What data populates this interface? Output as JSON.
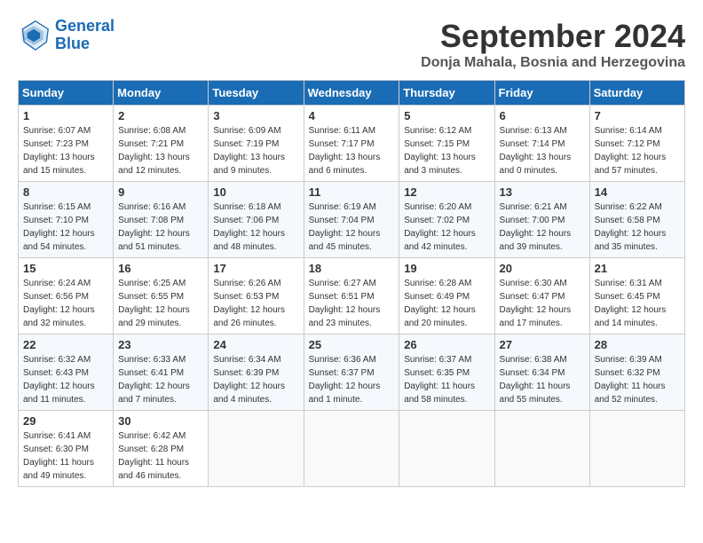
{
  "logo": {
    "line1": "General",
    "line2": "Blue"
  },
  "title": "September 2024",
  "subtitle": "Donja Mahala, Bosnia and Herzegovina",
  "days_header": [
    "Sunday",
    "Monday",
    "Tuesday",
    "Wednesday",
    "Thursday",
    "Friday",
    "Saturday"
  ],
  "weeks": [
    [
      {
        "day": "1",
        "sunrise": "6:07 AM",
        "sunset": "7:23 PM",
        "daylight": "13 hours and 15 minutes."
      },
      {
        "day": "2",
        "sunrise": "6:08 AM",
        "sunset": "7:21 PM",
        "daylight": "13 hours and 12 minutes."
      },
      {
        "day": "3",
        "sunrise": "6:09 AM",
        "sunset": "7:19 PM",
        "daylight": "13 hours and 9 minutes."
      },
      {
        "day": "4",
        "sunrise": "6:11 AM",
        "sunset": "7:17 PM",
        "daylight": "13 hours and 6 minutes."
      },
      {
        "day": "5",
        "sunrise": "6:12 AM",
        "sunset": "7:15 PM",
        "daylight": "13 hours and 3 minutes."
      },
      {
        "day": "6",
        "sunrise": "6:13 AM",
        "sunset": "7:14 PM",
        "daylight": "13 hours and 0 minutes."
      },
      {
        "day": "7",
        "sunrise": "6:14 AM",
        "sunset": "7:12 PM",
        "daylight": "12 hours and 57 minutes."
      }
    ],
    [
      {
        "day": "8",
        "sunrise": "6:15 AM",
        "sunset": "7:10 PM",
        "daylight": "12 hours and 54 minutes."
      },
      {
        "day": "9",
        "sunrise": "6:16 AM",
        "sunset": "7:08 PM",
        "daylight": "12 hours and 51 minutes."
      },
      {
        "day": "10",
        "sunrise": "6:18 AM",
        "sunset": "7:06 PM",
        "daylight": "12 hours and 48 minutes."
      },
      {
        "day": "11",
        "sunrise": "6:19 AM",
        "sunset": "7:04 PM",
        "daylight": "12 hours and 45 minutes."
      },
      {
        "day": "12",
        "sunrise": "6:20 AM",
        "sunset": "7:02 PM",
        "daylight": "12 hours and 42 minutes."
      },
      {
        "day": "13",
        "sunrise": "6:21 AM",
        "sunset": "7:00 PM",
        "daylight": "12 hours and 39 minutes."
      },
      {
        "day": "14",
        "sunrise": "6:22 AM",
        "sunset": "6:58 PM",
        "daylight": "12 hours and 35 minutes."
      }
    ],
    [
      {
        "day": "15",
        "sunrise": "6:24 AM",
        "sunset": "6:56 PM",
        "daylight": "12 hours and 32 minutes."
      },
      {
        "day": "16",
        "sunrise": "6:25 AM",
        "sunset": "6:55 PM",
        "daylight": "12 hours and 29 minutes."
      },
      {
        "day": "17",
        "sunrise": "6:26 AM",
        "sunset": "6:53 PM",
        "daylight": "12 hours and 26 minutes."
      },
      {
        "day": "18",
        "sunrise": "6:27 AM",
        "sunset": "6:51 PM",
        "daylight": "12 hours and 23 minutes."
      },
      {
        "day": "19",
        "sunrise": "6:28 AM",
        "sunset": "6:49 PM",
        "daylight": "12 hours and 20 minutes."
      },
      {
        "day": "20",
        "sunrise": "6:30 AM",
        "sunset": "6:47 PM",
        "daylight": "12 hours and 17 minutes."
      },
      {
        "day": "21",
        "sunrise": "6:31 AM",
        "sunset": "6:45 PM",
        "daylight": "12 hours and 14 minutes."
      }
    ],
    [
      {
        "day": "22",
        "sunrise": "6:32 AM",
        "sunset": "6:43 PM",
        "daylight": "12 hours and 11 minutes."
      },
      {
        "day": "23",
        "sunrise": "6:33 AM",
        "sunset": "6:41 PM",
        "daylight": "12 hours and 7 minutes."
      },
      {
        "day": "24",
        "sunrise": "6:34 AM",
        "sunset": "6:39 PM",
        "daylight": "12 hours and 4 minutes."
      },
      {
        "day": "25",
        "sunrise": "6:36 AM",
        "sunset": "6:37 PM",
        "daylight": "12 hours and 1 minute."
      },
      {
        "day": "26",
        "sunrise": "6:37 AM",
        "sunset": "6:35 PM",
        "daylight": "11 hours and 58 minutes."
      },
      {
        "day": "27",
        "sunrise": "6:38 AM",
        "sunset": "6:34 PM",
        "daylight": "11 hours and 55 minutes."
      },
      {
        "day": "28",
        "sunrise": "6:39 AM",
        "sunset": "6:32 PM",
        "daylight": "11 hours and 52 minutes."
      }
    ],
    [
      {
        "day": "29",
        "sunrise": "6:41 AM",
        "sunset": "6:30 PM",
        "daylight": "11 hours and 49 minutes."
      },
      {
        "day": "30",
        "sunrise": "6:42 AM",
        "sunset": "6:28 PM",
        "daylight": "11 hours and 46 minutes."
      },
      null,
      null,
      null,
      null,
      null
    ]
  ]
}
